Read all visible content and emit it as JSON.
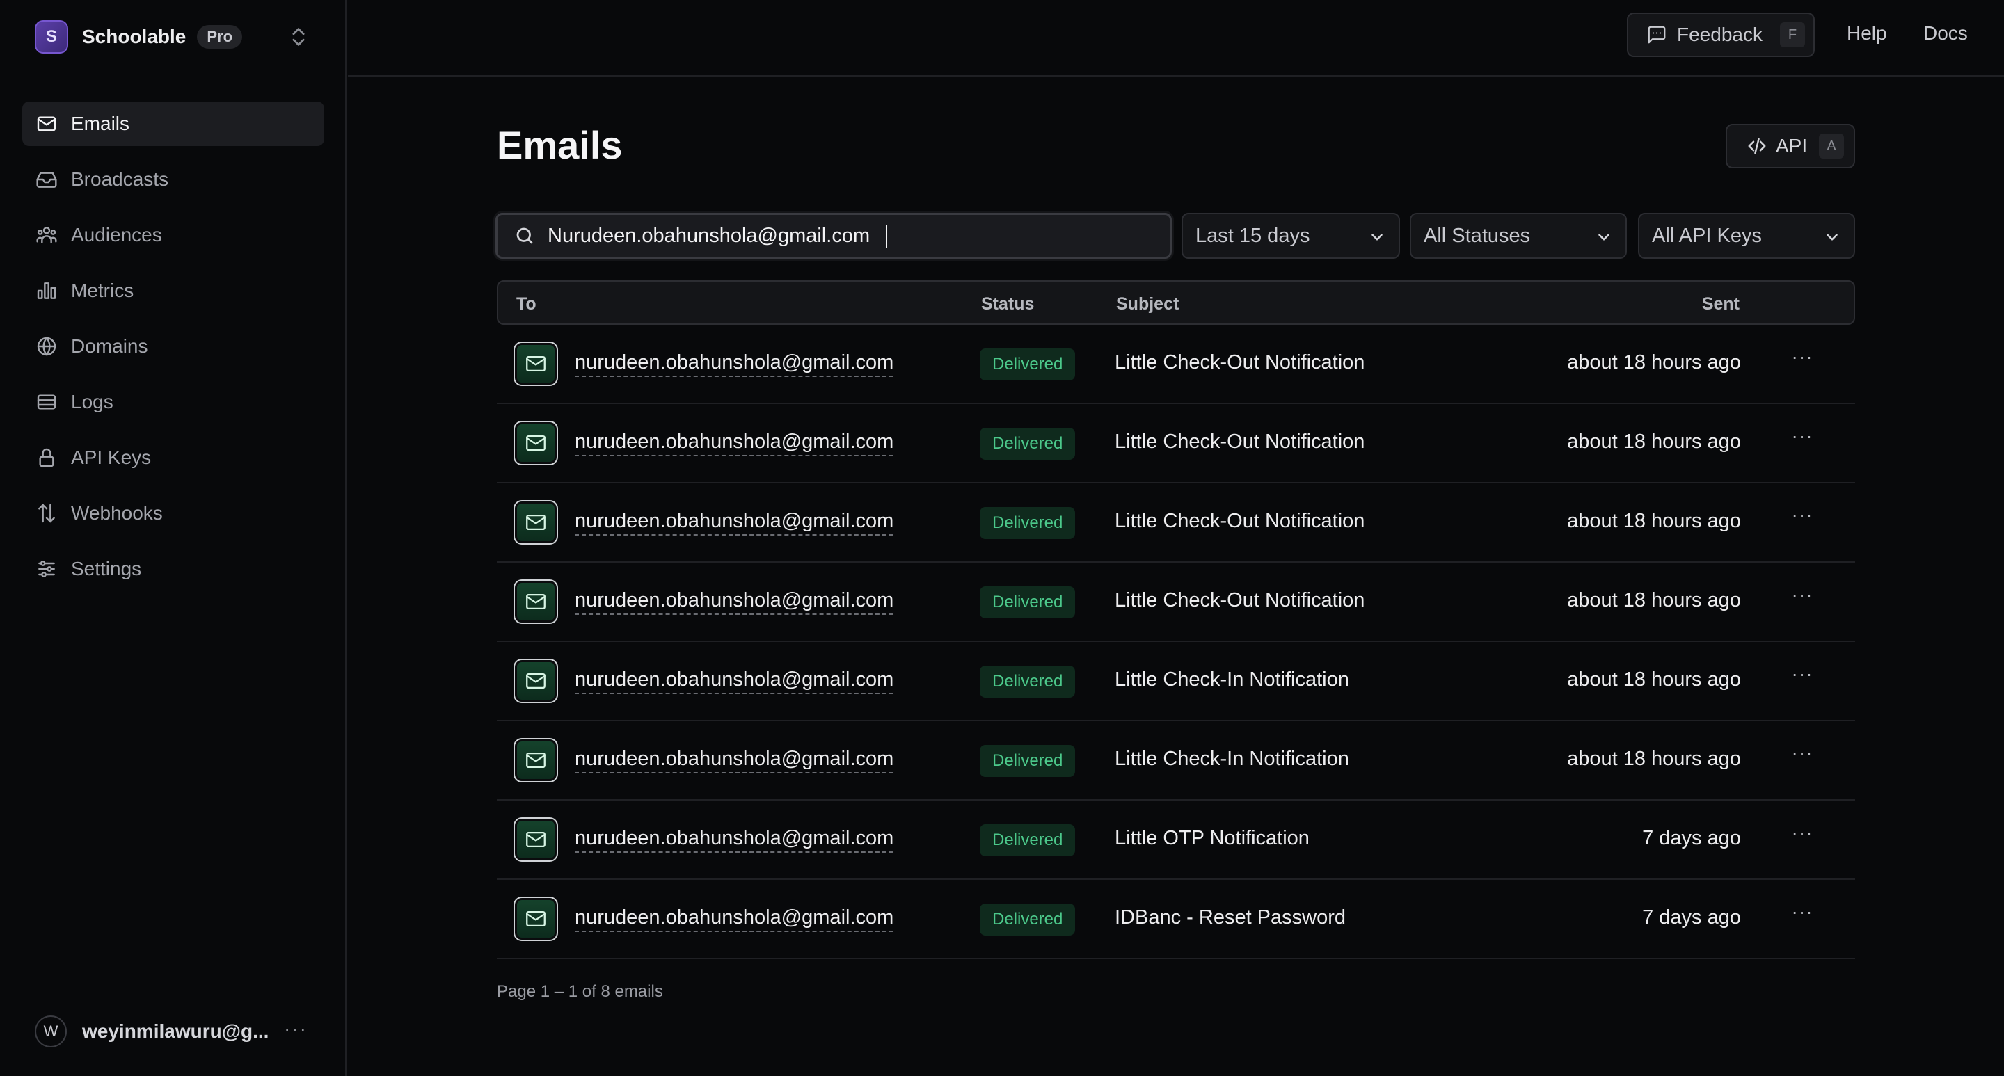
{
  "team": {
    "initial": "S",
    "name": "Schoolable",
    "plan": "Pro"
  },
  "sidebar": {
    "items": [
      {
        "label": "Emails",
        "icon": "mail-icon",
        "active": true
      },
      {
        "label": "Broadcasts",
        "icon": "inbox-icon",
        "active": false
      },
      {
        "label": "Audiences",
        "icon": "users-icon",
        "active": false
      },
      {
        "label": "Metrics",
        "icon": "bar-chart-icon",
        "active": false
      },
      {
        "label": "Domains",
        "icon": "globe-icon",
        "active": false
      },
      {
        "label": "Logs",
        "icon": "logs-icon",
        "active": false
      },
      {
        "label": "API Keys",
        "icon": "lock-icon",
        "active": false
      },
      {
        "label": "Webhooks",
        "icon": "webhook-icon",
        "active": false
      },
      {
        "label": "Settings",
        "icon": "sliders-icon",
        "active": false
      }
    ]
  },
  "user": {
    "initial": "W",
    "email": "weyinmilawuru@g...",
    "more": "···"
  },
  "topbar": {
    "feedback_label": "Feedback",
    "feedback_key": "F",
    "help_label": "Help",
    "docs_label": "Docs"
  },
  "main": {
    "title": "Emails",
    "api_label": "API",
    "api_key": "A",
    "search_value": "Nurudeen.obahunshola@gmail.com",
    "filters": {
      "date": "Last 15 days",
      "status": "All Statuses",
      "api_keys": "All API Keys"
    },
    "columns": {
      "to": "To",
      "status": "Status",
      "subject": "Subject",
      "sent": "Sent"
    },
    "rows": [
      {
        "to": "nurudeen.obahunshola@gmail.com",
        "status": "Delivered",
        "subject": "Little Check-Out Notification",
        "sent": "about 18 hours ago"
      },
      {
        "to": "nurudeen.obahunshola@gmail.com",
        "status": "Delivered",
        "subject": "Little Check-Out Notification",
        "sent": "about 18 hours ago"
      },
      {
        "to": "nurudeen.obahunshola@gmail.com",
        "status": "Delivered",
        "subject": "Little Check-Out Notification",
        "sent": "about 18 hours ago"
      },
      {
        "to": "nurudeen.obahunshola@gmail.com",
        "status": "Delivered",
        "subject": "Little Check-Out Notification",
        "sent": "about 18 hours ago"
      },
      {
        "to": "nurudeen.obahunshola@gmail.com",
        "status": "Delivered",
        "subject": "Little Check-In Notification",
        "sent": "about 18 hours ago"
      },
      {
        "to": "nurudeen.obahunshola@gmail.com",
        "status": "Delivered",
        "subject": "Little Check-In Notification",
        "sent": "about 18 hours ago"
      },
      {
        "to": "nurudeen.obahunshola@gmail.com",
        "status": "Delivered",
        "subject": "Little OTP Notification",
        "sent": "7 days ago"
      },
      {
        "to": "nurudeen.obahunshola@gmail.com",
        "status": "Delivered",
        "subject": "IDBanc - Reset Password",
        "sent": "7 days ago"
      }
    ],
    "pagination": "Page 1 – 1 of 8 emails"
  },
  "colors": {
    "background": "#08090b",
    "accent_green": "#4cc98b",
    "status_bg": "#0f2a1d",
    "team_avatar": "#5b3fa8"
  }
}
